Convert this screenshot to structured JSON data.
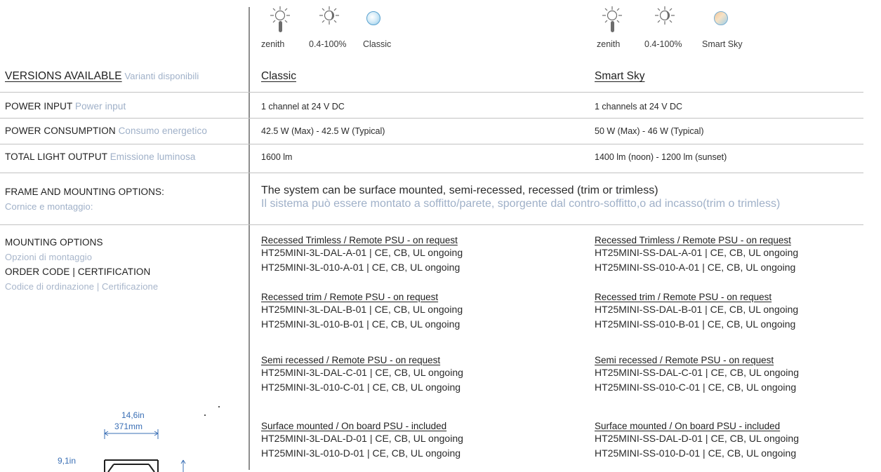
{
  "icons_left": [
    {
      "caption": "zenith",
      "icon": "zenith-lamp-icon"
    },
    {
      "caption": "0.4-100%",
      "icon": "dimming-sun-icon"
    },
    {
      "caption": "Classic",
      "icon": "classic-color-dot-icon"
    }
  ],
  "icons_right": [
    {
      "caption": "zenith",
      "icon": "zenith-lamp-icon"
    },
    {
      "caption": "0.4-100%",
      "icon": "dimming-sun-icon"
    },
    {
      "caption": "Smart Sky",
      "icon": "smart-sky-color-dot-icon"
    }
  ],
  "versions": {
    "label": "VERSIONS AVAILABLE",
    "label_it": "Varianti disponibili",
    "classic": "Classic",
    "smart_sky": "Smart Sky"
  },
  "rows": [
    {
      "label": "POWER INPUT",
      "label_it": "Power input",
      "classic": "1 channel at 24 V DC",
      "smart_sky": "1 channels at 24 V DC"
    },
    {
      "label": "POWER CONSUMPTION",
      "label_it": "Consumo energetico",
      "classic": "42.5 W (Max) - 42.5 W (Typical)",
      "smart_sky": "50 W (Max) - 46 W (Typical)"
    },
    {
      "label": "TOTAL LIGHT OUTPUT",
      "label_it": "Emissione luminosa",
      "classic": "1600 lm",
      "smart_sky": "1400 lm (noon) - 1200 lm (sunset)"
    }
  ],
  "frame": {
    "label": "FRAME AND MOUNTING OPTIONS:",
    "label_it": "Cornice e montaggio:",
    "text_en": "The system can be surface mounted, semi-recessed, recessed (trim or trimless)",
    "text_it": "Il sistema può essere montato a soffitto/parete, sporgente dal contro-soffitto,o ad incasso(trim o trimless)"
  },
  "mounting": {
    "label1": "MOUNTING OPTIONS",
    "label1_it": "Opzioni di montaggio",
    "label2": "ORDER CODE  |  CERTIFICATION",
    "label2_it": "Codice di ordinazione  |  Certificazione"
  },
  "groups_classic": [
    {
      "title": "Recessed Trimless / Remote PSU - on request",
      "codes": [
        "HT25MINI-3L-DAL-A-01  |  CE, CB, UL ongoing",
        "HT25MINI-3L-010-A-01  |  CE, CB, UL ongoing"
      ]
    },
    {
      "title": "Recessed trim / Remote PSU - on request",
      "codes": [
        "HT25MINI-3L-DAL-B-01  |  CE, CB, UL ongoing",
        "HT25MINI-3L-010-B-01  |  CE, CB, UL ongoing"
      ]
    },
    {
      "title": "Semi recessed / Remote PSU - on request",
      "codes": [
        "HT25MINI-3L-DAL-C-01  |  CE, CB, UL ongoing",
        "HT25MINI-3L-010-C-01  |  CE, CB, UL ongoing"
      ]
    },
    {
      "title": "Surface mounted /  On board PSU - included",
      "codes": [
        "HT25MINI-3L-DAL-D-01  |  CE, CB, UL ongoing",
        "HT25MINI-3L-010-D-01  |  CE, CB, UL ongoing"
      ]
    }
  ],
  "groups_smart": [
    {
      "title": "Recessed Trimless / Remote PSU - on request",
      "codes": [
        "HT25MINI-SS-DAL-A-01  |  CE, CB, UL ongoing",
        "HT25MINI-SS-010-A-01  |  CE, CB, UL ongoing"
      ]
    },
    {
      "title": "Recessed trim / Remote PSU - on request",
      "codes": [
        "HT25MINI-SS-DAL-B-01  |  CE, CB, UL ongoing",
        "HT25MINI-SS-010-B-01  |  CE, CB, UL ongoing"
      ]
    },
    {
      "title": "Semi recessed / Remote PSU - on request",
      "codes": [
        "HT25MINI-SS-DAL-C-01  |  CE, CB, UL ongoing",
        "HT25MINI-SS-010-C-01  |  CE, CB, UL ongoing"
      ]
    },
    {
      "title": "Surface mounted / On board PSU - included",
      "codes": [
        "HT25MINI-SS-DAL-D-01  |  CE, CB, UL ongoing",
        "HT25MINI-SS-010-D-01  |  CE, CB, UL ongoing"
      ]
    }
  ],
  "drawing": {
    "width_in": "14,6in",
    "width_mm": "371mm",
    "height_in": "9,1in"
  },
  "colors": {
    "label_italian": "#9fb0c8",
    "divider": "#c2c2c2",
    "vertical_rule": "#8e8e8e",
    "dimension": "#3a6fb5"
  }
}
